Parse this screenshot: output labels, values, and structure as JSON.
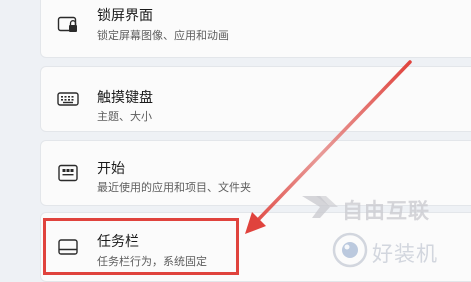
{
  "settings_items": [
    {
      "title": "锁屏界面",
      "subtitle": "锁定屏幕图像、应用和动画",
      "icon": "lock-screen-icon"
    },
    {
      "title": "触摸键盘",
      "subtitle": "主题、大小",
      "icon": "keyboard-icon"
    },
    {
      "title": "开始",
      "subtitle": "最近使用的应用和项目、文件夹",
      "icon": "start-menu-icon"
    },
    {
      "title": "任务栏",
      "subtitle": "任务栏行为，系统固定",
      "icon": "taskbar-icon"
    }
  ],
  "annotation": {
    "highlight_color": "#e0433d",
    "highlighted_item": "任务栏"
  },
  "watermarks": {
    "top_text": "自由互联",
    "bottom_text": "好装机"
  },
  "colors": {
    "background": "#eef1f5",
    "card": "#fbfbfb",
    "accent_red": "#e0433d"
  }
}
